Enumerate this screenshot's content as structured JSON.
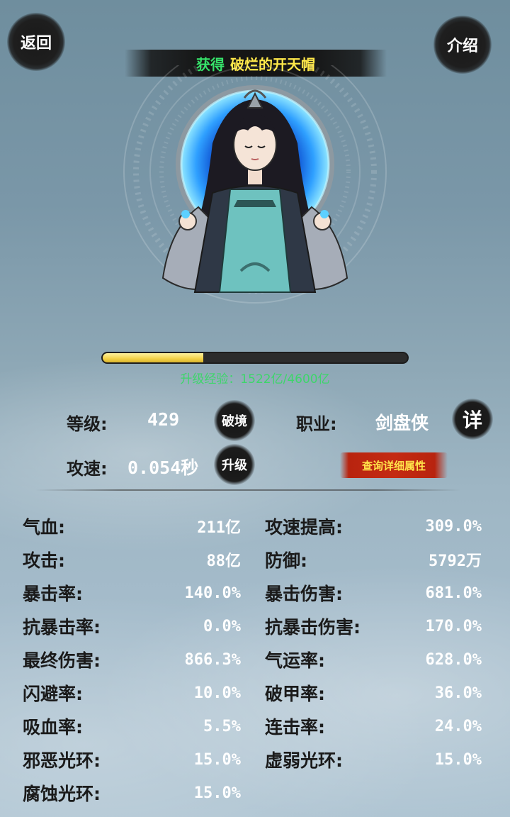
{
  "header": {
    "back_label": "返回",
    "intro_label": "介绍",
    "title_prefix": "获得",
    "title_item": "破烂的开天帽"
  },
  "experience": {
    "label": "升级经验：1522亿/4600亿",
    "progress": 0.33
  },
  "info": {
    "level_label": "等级:",
    "level_value": "429",
    "breakthrough_label": "破境",
    "class_label": "职业:",
    "class_value": "剑盘侠",
    "detail_btn": "详",
    "attack_speed_label": "攻速:",
    "attack_speed_value": "0.054秒",
    "upgrade_label": "升级",
    "query_label": "查询详细属性"
  },
  "stats": {
    "left": [
      {
        "name": "气血:",
        "value": "211亿"
      },
      {
        "name": "攻击:",
        "value": "88亿"
      },
      {
        "name": "暴击率:",
        "value": "140.0%"
      },
      {
        "name": "抗暴击率:",
        "value": "0.0%"
      },
      {
        "name": "最终伤害:",
        "value": "866.3%"
      },
      {
        "name": "闪避率:",
        "value": "10.0%"
      },
      {
        "name": "吸血率:",
        "value": "5.5%"
      },
      {
        "name": "邪恶光环:",
        "value": "15.0%"
      },
      {
        "name": "腐蚀光环:",
        "value": "15.0%"
      }
    ],
    "right": [
      {
        "name": "攻速提高:",
        "value": "309.0%"
      },
      {
        "name": "防御:",
        "value": "5792万"
      },
      {
        "name": "暴击伤害:",
        "value": "681.0%"
      },
      {
        "name": "抗暴击伤害:",
        "value": "170.0%"
      },
      {
        "name": "气运率:",
        "value": "628.0%"
      },
      {
        "name": "破甲率:",
        "value": "36.0%"
      },
      {
        "name": "连击率:",
        "value": "24.0%"
      },
      {
        "name": "虚弱光环:",
        "value": "15.0%"
      }
    ]
  },
  "colors": {
    "title_prefix": "#36e26a",
    "title_item": "#ffe84a",
    "exp_fill": "#f4d248",
    "exp_text": "#3dd66a",
    "query_button": "#c42a12"
  }
}
